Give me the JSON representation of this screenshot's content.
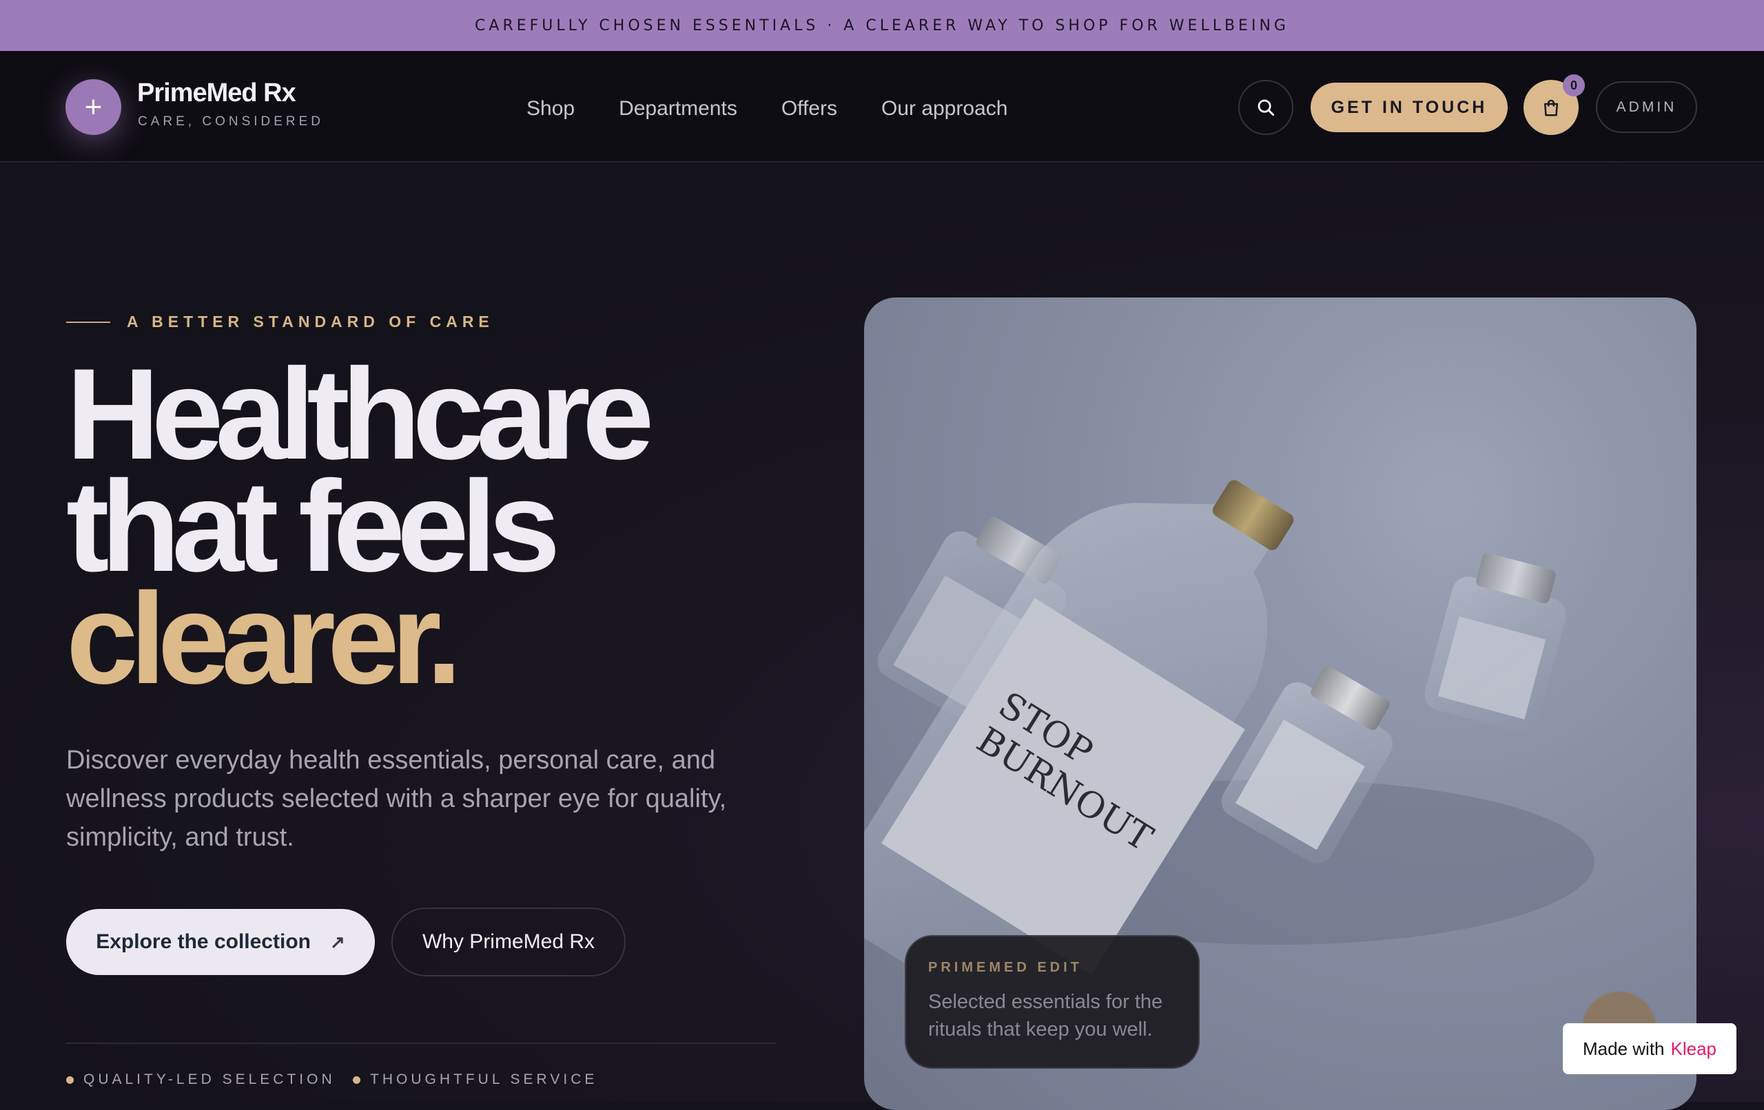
{
  "announcement": "CAREFULLY CHOSEN ESSENTIALS · A CLEARER WAY TO SHOP FOR WELLBEING",
  "brand": {
    "name": "PrimeMed Rx",
    "tagline": "CARE, CONSIDERED",
    "logo_icon": "plus-icon"
  },
  "nav": {
    "items": [
      {
        "label": "Shop"
      },
      {
        "label": "Departments"
      },
      {
        "label": "Offers"
      },
      {
        "label": "Our approach"
      }
    ]
  },
  "header_actions": {
    "search_icon": "search-icon",
    "contact_label": "GET IN TOUCH",
    "cart_icon": "shopping-bag-icon",
    "cart_count": "0",
    "admin_label": "ADMIN"
  },
  "hero": {
    "eyebrow": "A BETTER STANDARD OF CARE",
    "headline_line1": "Healthcare",
    "headline_line2": "that feels",
    "headline_accent": "clearer.",
    "lede": "Discover everyday health essentials, personal care, and wellness products selected with a sharper eye for quality, simplicity, and trust.",
    "primary_cta": "Explore the collection",
    "primary_cta_icon": "arrow-up-right-icon",
    "secondary_cta": "Why PrimeMed Rx",
    "features": [
      {
        "label": "QUALITY-LED SELECTION"
      },
      {
        "label": "THOUGHTFUL SERVICE"
      }
    ]
  },
  "photo": {
    "main_bottle_label_line1": "STOP",
    "main_bottle_label_line2": "BURNOUT",
    "card_label": "PRIMEMED EDIT",
    "card_text": "Selected essentials for the rituals that keep you well."
  },
  "badge": {
    "prefix": "Made with",
    "brand": "Kleap"
  },
  "colors": {
    "announcement_bg": "#9c7db9",
    "accent_gold": "#dbb98d",
    "accent_purple": "#9b78b6",
    "page_bg": "#14121a"
  }
}
